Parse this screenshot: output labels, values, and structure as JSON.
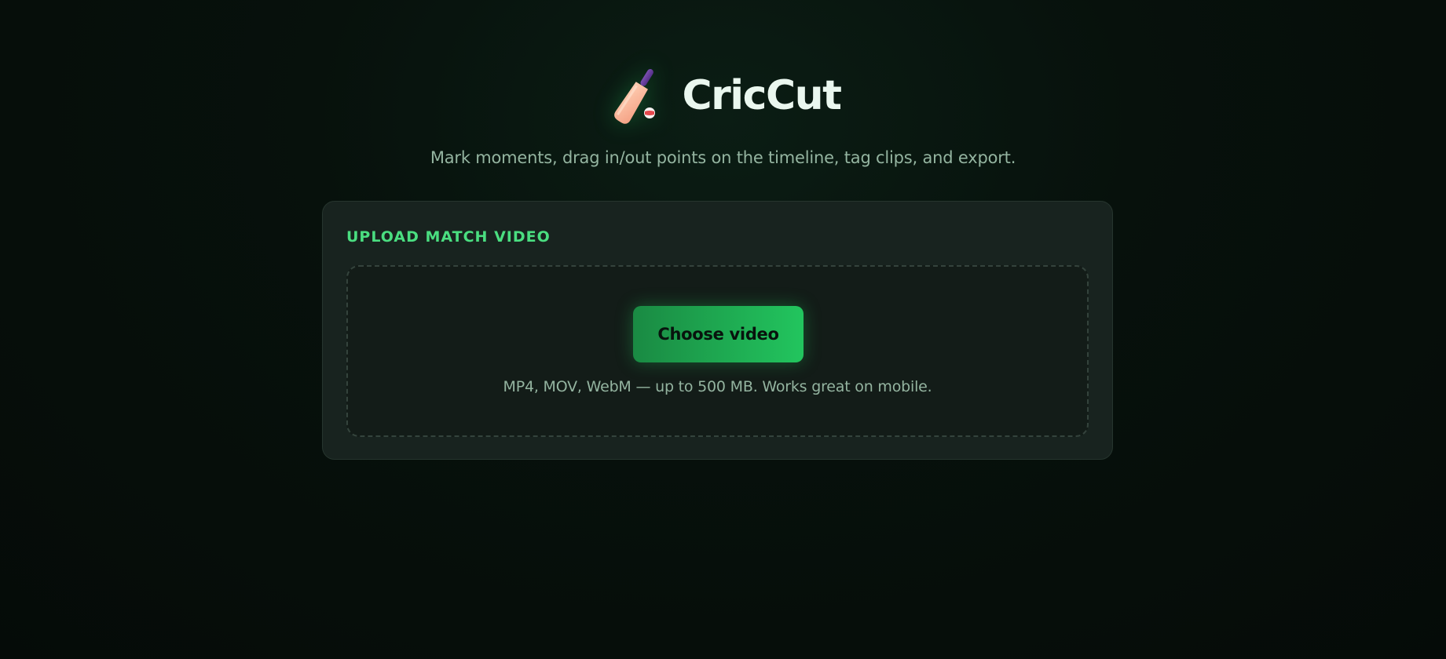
{
  "app": {
    "title": "CricCut",
    "logo_icon": "cricket-bat-icon",
    "tagline": "Mark moments, drag in/out points on the timeline, tag clips, and export."
  },
  "upload": {
    "title": "UPLOAD MATCH VIDEO",
    "button_label": "Choose video",
    "hint": "MP4, MOV, WebM — up to 500 MB. Works great on mobile."
  },
  "colors": {
    "accent": "#4ade80",
    "button_gradient_start": "#1a8a43",
    "button_gradient_end": "#22c55e",
    "background": "#07110c",
    "card": "#18231f",
    "muted_text": "#94b4a0"
  }
}
